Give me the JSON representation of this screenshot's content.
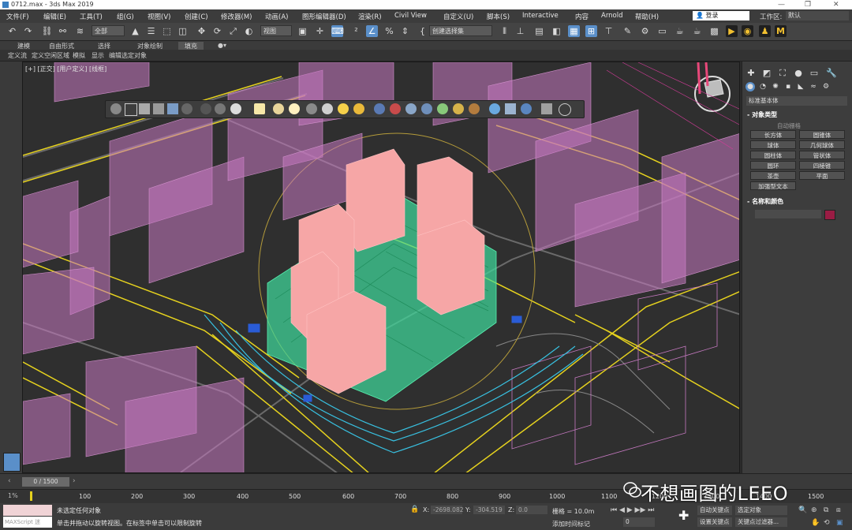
{
  "window": {
    "title": "0712.max - 3ds Max 2019"
  },
  "menu": {
    "items": [
      "文件(F)",
      "编辑(E)",
      "工具(T)",
      "组(G)",
      "视图(V)",
      "创建(C)",
      "修改器(M)",
      "动画(A)",
      "图形编辑器(D)",
      "渲染(R)",
      "Civil View",
      "自定义(U)",
      "脚本(S)",
      "Interactive",
      "内容",
      "Arnold",
      "帮助(H)"
    ],
    "login": "登录",
    "workspace_label": "工作区:",
    "workspace_value": "默认"
  },
  "toolbar": {
    "filter": "全部",
    "view": "视图",
    "selection_set": "创建选择集"
  },
  "ribbon": {
    "tabs": [
      "建模",
      "自由形式",
      "选择",
      "对象绘制",
      "填充"
    ],
    "subtabs": [
      "定义流",
      "定义空闲区域",
      "模拟",
      "显示",
      "编辑选定对象"
    ]
  },
  "viewport": {
    "label": "[+] [正交] [用户定义] [线框]"
  },
  "command_panel": {
    "category": "标准基本体",
    "object_type_title": "对象类型",
    "autogrid": "自动栅格",
    "objects": [
      "长方体",
      "圆锥体",
      "球体",
      "几何球体",
      "圆柱体",
      "管状体",
      "圆环",
      "四棱锥",
      "茶壶",
      "平面",
      "加强型文本"
    ],
    "name_color_title": "名称和颜色",
    "swatch_color": "#9a1c44"
  },
  "timeline": {
    "slider": "0 / 1500",
    "percent": "1%",
    "ticks": [
      "100",
      "200",
      "300",
      "400",
      "500",
      "600",
      "700",
      "800",
      "900",
      "1000",
      "1100",
      "1200",
      "1300",
      "1400",
      "1500"
    ]
  },
  "status": {
    "maxscript": "MAXScript 迷",
    "line1": "未选定任何对象",
    "line2": "单击并拖动以旋转视图。在标签中单击可以限制旋转",
    "x_label": "X:",
    "x_value": "-2698.082",
    "y_label": "Y:",
    "y_value": "-304.519",
    "z_label": "Z:",
    "z_value": "0.0",
    "grid": "栅格 = 10.0m",
    "add_time_tag": "添加时间标记",
    "auto_key": "自动关键点",
    "selected_object": "选定对象",
    "set_key": "设置关键点",
    "key_filter": "关键点过滤器...",
    "frame": "0"
  },
  "watermark": "不想画图的LEEO"
}
